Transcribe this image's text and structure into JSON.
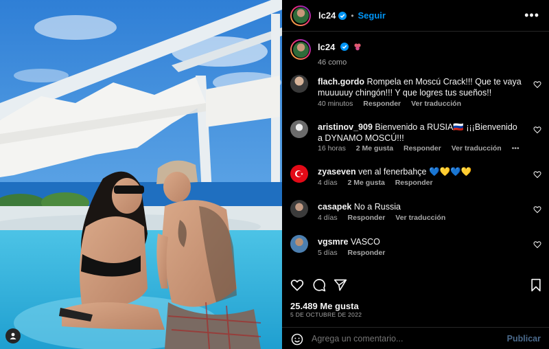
{
  "post": {
    "username": "lc24",
    "follow_label": "Seguir",
    "separator": "•",
    "more_label": "•••",
    "caption_sub": "46 como"
  },
  "comments": [
    {
      "user": "flach.gordo",
      "text": "Rompela en Moscú Crack!!! Que te vaya muuuuuy chingón!!! Y que logres tus sueños!!",
      "time": "40 minutos",
      "likes": "",
      "reply": "Responder",
      "translate": "Ver traducción"
    },
    {
      "user": "aristinov_909",
      "text": "Bienvenido a RUSIA🇷🇺 ¡¡¡Bienvenido a DYNAMO MOSCÚ!!!",
      "time": "16 horas",
      "likes": "2 Me gusta",
      "reply": "Responder",
      "translate": "Ver traducción",
      "extra": "•••"
    },
    {
      "user": "zyaseven",
      "text": "ven al fenerbahçe 💙💛💙💛",
      "time": "4 días",
      "likes": "2 Me gusta",
      "reply": "Responder",
      "translate": ""
    },
    {
      "user": "casapek",
      "text": "No a Russia",
      "time": "4 días",
      "likes": "",
      "reply": "Responder",
      "translate": "Ver traducción"
    },
    {
      "user": "vgsmre",
      "text": "VASCO",
      "time": "5 días",
      "likes": "",
      "reply": "Responder",
      "translate": ""
    }
  ],
  "footer": {
    "likes": "25.489 Me gusta",
    "date": "5 DE OCTUBRE DE 2022",
    "comment_placeholder": "Agrega un comentario...",
    "publish_label": "Publicar"
  },
  "icons": {
    "like": "heart-icon",
    "comment": "comment-icon",
    "share": "share-icon",
    "save": "bookmark-icon",
    "emoji": "smile-icon",
    "more": "more-icon",
    "user_tag": "user-tag-icon"
  },
  "colors": {
    "background": "#000000",
    "accent": "#0095f6",
    "muted_text": "#a8a8a8",
    "publish_disabled": "#4b6a8c",
    "divider": "#262626"
  }
}
